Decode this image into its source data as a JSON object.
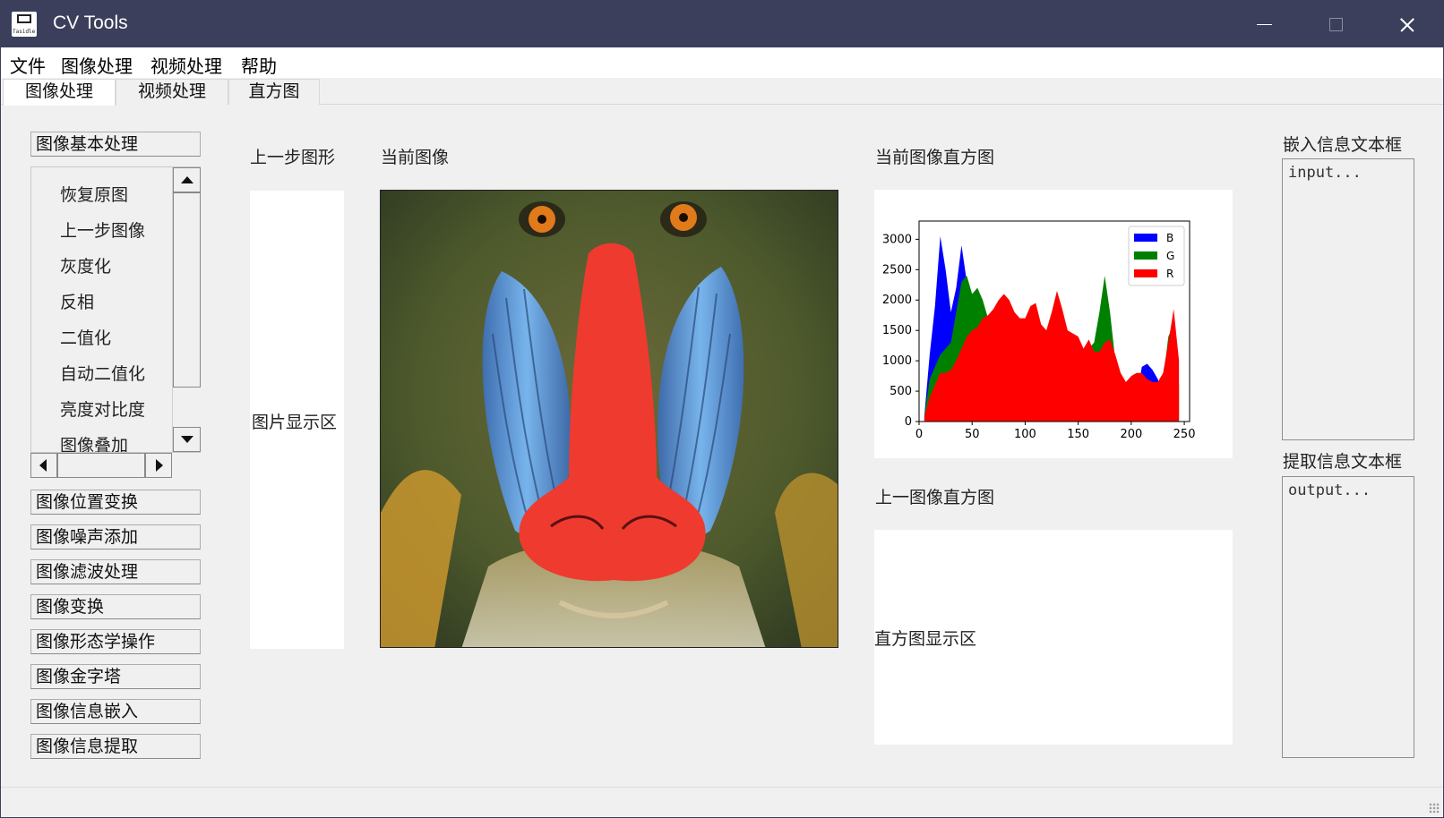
{
  "window": {
    "title": "CV Tools",
    "icon_label": "Tasidle"
  },
  "menu": [
    "文件",
    "图像处理",
    "视频处理",
    "帮助"
  ],
  "tabs": [
    "图像处理",
    "视频处理",
    "直方图"
  ],
  "sidebar": {
    "basic_button": "图像基本处理",
    "list_items": [
      "恢复原图",
      "上一步图像",
      "灰度化",
      "反相",
      "二值化",
      "自动二值化",
      "亮度对比度",
      "图像叠加"
    ],
    "buttons": [
      "图像位置变换",
      "图像噪声添加",
      "图像滤波处理",
      "图像变换",
      "图像形态学操作",
      "图像金字塔",
      "图像信息嵌入",
      "图像信息提取"
    ]
  },
  "labels": {
    "prev_shape": "上一步图形",
    "current_image": "当前图像",
    "current_hist": "当前图像直方图",
    "prev_hist": "上一图像直方图",
    "embed_text": "嵌入信息文本框",
    "extract_text": "提取信息文本框"
  },
  "placeholders": {
    "image_area": "图片显示区",
    "hist_area": "直方图显示区",
    "input": "input...",
    "output": "output..."
  },
  "chart_data": {
    "type": "area",
    "xlim": [
      0,
      255
    ],
    "ylim": [
      0,
      3300
    ],
    "xticks": [
      0,
      50,
      100,
      150,
      200,
      250
    ],
    "yticks": [
      0,
      500,
      1000,
      1500,
      2000,
      2500,
      3000
    ],
    "legend_position": "top-right",
    "x": [
      5,
      10,
      15,
      20,
      25,
      30,
      35,
      40,
      45,
      50,
      55,
      60,
      65,
      70,
      75,
      80,
      85,
      90,
      95,
      100,
      105,
      110,
      115,
      120,
      125,
      130,
      135,
      140,
      145,
      150,
      155,
      160,
      165,
      170,
      175,
      180,
      185,
      190,
      195,
      200,
      205,
      210,
      215,
      220,
      225,
      230,
      235,
      240,
      245
    ],
    "series": [
      {
        "name": "B",
        "color": "#0000ff",
        "values": [
          100,
          1100,
          1900,
          3050,
          2500,
          1800,
          2200,
          2900,
          2300,
          1900,
          1600,
          1500,
          1550,
          1500,
          1600,
          1700,
          1500,
          1550,
          1450,
          1400,
          1400,
          1450,
          1350,
          1300,
          1500,
          1550,
          1350,
          1100,
          1000,
          1050,
          1000,
          1050,
          1000,
          1000,
          1150,
          1100,
          700,
          400,
          350,
          350,
          400,
          900,
          950,
          850,
          700,
          400,
          500,
          200,
          0
        ]
      },
      {
        "name": "G",
        "color": "#008000",
        "values": [
          100,
          700,
          900,
          1100,
          1200,
          1300,
          1800,
          2300,
          2400,
          2100,
          2200,
          2000,
          1700,
          1700,
          1900,
          1900,
          1800,
          1700,
          1600,
          1550,
          1700,
          1600,
          1450,
          1350,
          1700,
          1900,
          1700,
          1400,
          1250,
          1150,
          1200,
          1200,
          1300,
          1800,
          2400,
          1800,
          1000,
          400,
          300,
          300,
          500,
          700,
          700,
          600,
          500,
          700,
          1400,
          1600,
          600
        ]
      },
      {
        "name": "R",
        "color": "#ff0000",
        "values": [
          80,
          400,
          600,
          800,
          800,
          850,
          1000,
          1200,
          1400,
          1500,
          1550,
          1700,
          1750,
          1850,
          2000,
          2100,
          2000,
          1800,
          1700,
          1700,
          1900,
          1950,
          1600,
          1500,
          1800,
          2150,
          1850,
          1500,
          1450,
          1400,
          1200,
          1350,
          1150,
          1150,
          1300,
          1350,
          1100,
          800,
          650,
          750,
          800,
          800,
          700,
          650,
          650,
          800,
          1300,
          1850,
          1000
        ]
      }
    ]
  }
}
